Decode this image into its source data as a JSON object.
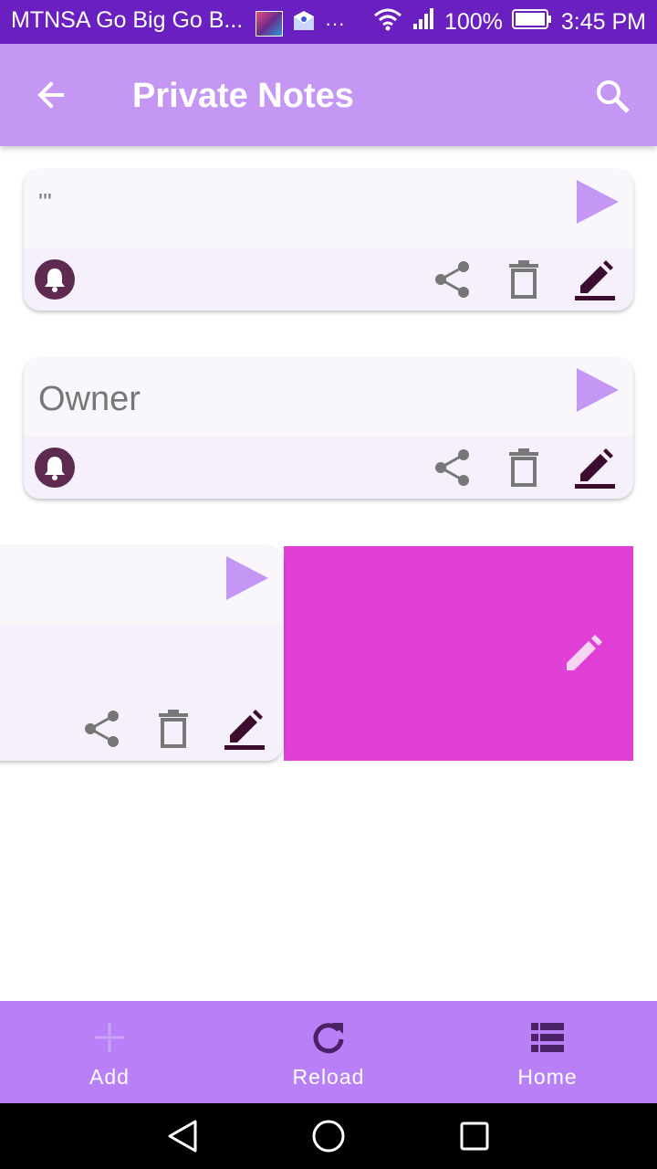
{
  "status_bar": {
    "carrier": "MTNSA Go Big Go B...",
    "more": "···",
    "battery": "100%",
    "time": "3:45 PM"
  },
  "app_bar": {
    "title": "Private Notes",
    "back_icon": "arrow-left-icon",
    "search_icon": "search-icon"
  },
  "notes": [
    {
      "text": "'''",
      "has_reminder": true
    },
    {
      "text": "Owner",
      "has_reminder": true
    },
    {
      "text": "",
      "has_reminder": false,
      "swiped": true
    }
  ],
  "swipe_action": {
    "icon": "pencil-icon",
    "color": "#e040d6"
  },
  "bottom_nav": {
    "items": [
      {
        "label": "Add",
        "icon": "plus-icon"
      },
      {
        "label": "Reload",
        "icon": "refresh-icon"
      },
      {
        "label": "Home",
        "icon": "list-icon"
      }
    ]
  },
  "colors": {
    "status_bar": "#6a1fc0",
    "app_bar": "#c597f4",
    "bottom_nav": "#b87ff7",
    "accent_dark": "#5e2a4f"
  }
}
